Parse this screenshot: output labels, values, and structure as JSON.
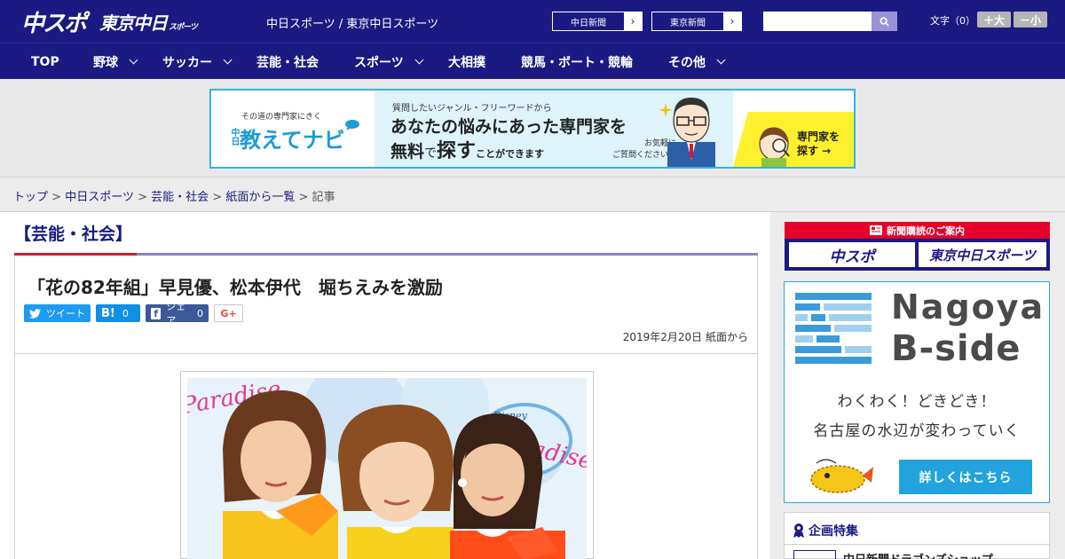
{
  "header": {
    "logo_main": "中スポ",
    "logo_tokyo": "東京中日",
    "logo_tokyo_small": "スポーツ",
    "site_title": "中日スポーツ / 東京中日スポーツ",
    "paper_links": [
      {
        "label": "中日新聞",
        "arrow": "›"
      },
      {
        "label": "東京新聞",
        "arrow": "›"
      }
    ],
    "search": {
      "value": "",
      "placeholder": ""
    },
    "font_size": {
      "label": "文字（0）",
      "increase": "＋大",
      "decrease": "－小"
    }
  },
  "nav": {
    "items": [
      {
        "label": "TOP"
      },
      {
        "label": "野球"
      },
      {
        "label": "サッカー"
      },
      {
        "label": "芸能・社会"
      },
      {
        "label": "スポーツ"
      },
      {
        "label": "大相撲"
      },
      {
        "label": "競馬・ボート・競輪"
      },
      {
        "label": "その他"
      }
    ]
  },
  "banner": {
    "left_sub": "その道の専門家にきく",
    "left_main": "教えてナビ",
    "left_tag": "中日",
    "mid_question": "質問したいジャンル・フリーワードから",
    "mid_line1": "あなたの悩みにあった専門家を",
    "mid_line2a": "無料",
    "mid_line2b": "で",
    "mid_line2c": "探す",
    "mid_line2d": "ことができます",
    "mid_note1": "お気軽に",
    "mid_note2": "ご質問ください！",
    "cta_line1": "専門家を",
    "cta_line2": "探す →"
  },
  "breadcrumb": {
    "items": [
      "トップ",
      "中日スポーツ",
      "芸能・社会",
      "紙面から一覧"
    ],
    "separator": ">",
    "current": "記事"
  },
  "article": {
    "category": "【芸能・社会】",
    "headline": "「花の82年組」早見優、松本伊代　堀ちえみを激励",
    "share": {
      "tweet": "ツイート",
      "hatena_label": "B!",
      "hatena_count": "0",
      "facebook_label": "シェア",
      "facebook_count": "0",
      "gplus": "G+"
    },
    "date": "2019年2月20日",
    "source": "紙面から",
    "photo_sign_left": "Paradise",
    "photo_sign_right": "Paradise",
    "photo_sign_brand": "Disney"
  },
  "sidebar": {
    "subscription": {
      "header": "新聞購読のご案内",
      "link_a": "中スポ",
      "link_b": "東京中日スポーツ"
    },
    "bside": {
      "title1": "Nagoya",
      "title2": "B-side",
      "line1": "わくわく！どきどき！",
      "line2": "名古屋の水辺が変わっていく",
      "button": "詳しくはこちら"
    },
    "feature": {
      "heading": "企画特集",
      "item1": "中日新聞ドラゴンズショップ"
    }
  },
  "colors": {
    "brand_navy": "#1b1a82",
    "accent_red": "#e4002b",
    "banner_blue": "#34b4dd",
    "cta_yellow": "#fff02e"
  }
}
